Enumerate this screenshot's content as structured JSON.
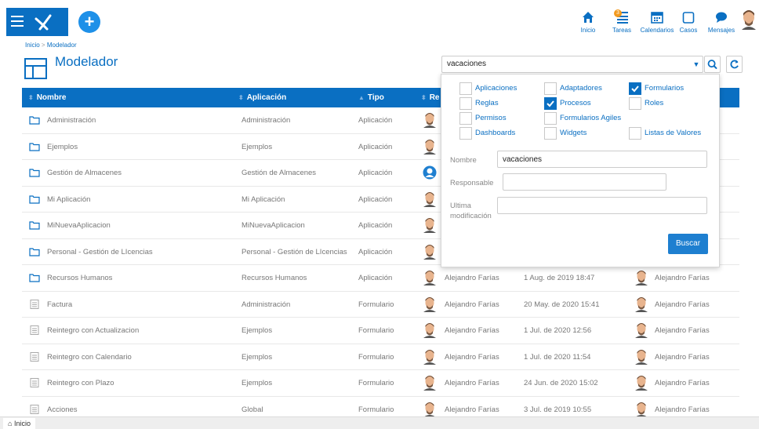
{
  "topbar": {
    "nav": [
      {
        "label": "Inicio",
        "icon": "home-icon"
      },
      {
        "label": "Tareas",
        "icon": "tasks-icon",
        "badge": "3"
      },
      {
        "label": "Calendarios",
        "icon": "calendar-icon"
      },
      {
        "label": "Casos",
        "icon": "cases-icon"
      },
      {
        "label": "Mensajes",
        "icon": "chat-icon"
      }
    ],
    "accent": "#0a6fc2"
  },
  "breadcrumb": {
    "root": "Inicio",
    "sep": ">",
    "current": "Modelador"
  },
  "page_title": "Modelador",
  "search": {
    "value": "vacaciones"
  },
  "table": {
    "headers": [
      "Nombre",
      "Aplicación",
      "Tipo",
      "Re"
    ],
    "rows": [
      {
        "name": "Administración",
        "app": "Administración",
        "type": "Aplicación",
        "kind": "folder",
        "resp": "",
        "date": "",
        "resp2": "",
        "avatar": "man"
      },
      {
        "name": "Ejemplos",
        "app": "Ejemplos",
        "type": "Aplicación",
        "kind": "folder",
        "resp": "",
        "date": "",
        "resp2": "",
        "avatar": "man"
      },
      {
        "name": "Gestión de Almacenes",
        "app": "Gestión de Almacenes",
        "type": "Aplicación",
        "kind": "folder",
        "resp": "",
        "date": "",
        "resp2": "",
        "avatar": "blue"
      },
      {
        "name": "Mi Aplicación",
        "app": "Mi Aplicación",
        "type": "Aplicación",
        "kind": "folder",
        "resp": "",
        "date": "",
        "resp2": "",
        "avatar": "man"
      },
      {
        "name": "MiNuevaAplicacion",
        "app": "MiNuevaAplicacion",
        "type": "Aplicación",
        "kind": "folder",
        "resp": "",
        "date": "",
        "resp2": "",
        "avatar": "man"
      },
      {
        "name": "Personal - Gestión de LIcencias",
        "app": "Personal - Gestión de LIcencias",
        "type": "Aplicación",
        "kind": "folder",
        "resp": "",
        "date": "",
        "resp2": "",
        "avatar": "man"
      },
      {
        "name": "Recursos Humanos",
        "app": "Recursos Humanos",
        "type": "Aplicación",
        "kind": "folder",
        "resp": "Alejandro Farías",
        "date": "1 Aug. de 2019 18:47",
        "resp2": "Alejandro Farías",
        "avatar": "man"
      },
      {
        "name": "Factura",
        "app": "Administración",
        "type": "Formulario",
        "kind": "form",
        "resp": "Alejandro Farías",
        "date": "20 May. de 2020 15:41",
        "resp2": "Alejandro Farías",
        "avatar": "man"
      },
      {
        "name": "Reintegro con Actualizacion",
        "app": "Ejemplos",
        "type": "Formulario",
        "kind": "form",
        "resp": "Alejandro Farías",
        "date": "1 Jul. de 2020 12:56",
        "resp2": "Alejandro Farías",
        "avatar": "man"
      },
      {
        "name": "Reintegro con Calendario",
        "app": "Ejemplos",
        "type": "Formulario",
        "kind": "form",
        "resp": "Alejandro Farías",
        "date": "1 Jul. de 2020 11:54",
        "resp2": "Alejandro Farías",
        "avatar": "man"
      },
      {
        "name": "Reintegro con Plazo",
        "app": "Ejemplos",
        "type": "Formulario",
        "kind": "form",
        "resp": "Alejandro Farías",
        "date": "24 Jun. de 2020 15:02",
        "resp2": "Alejandro Farías",
        "avatar": "man"
      },
      {
        "name": "Acciones",
        "app": "Global",
        "type": "Formulario",
        "kind": "form",
        "resp": "Alejandro Farías",
        "date": "3 Jul. de 2019 10:55",
        "resp2": "Alejandro Farías",
        "avatar": "man"
      }
    ]
  },
  "filter": {
    "options": [
      {
        "label": "Aplicaciones",
        "checked": false
      },
      {
        "label": "Adaptadores",
        "checked": false
      },
      {
        "label": "Formularios",
        "checked": true
      },
      {
        "label": "Reglas",
        "checked": false
      },
      {
        "label": "Procesos",
        "checked": true
      },
      {
        "label": "Roles",
        "checked": false
      },
      {
        "label": "Permisos",
        "checked": false
      },
      {
        "label": "Formularios Agiles",
        "checked": false
      },
      {
        "label": "Dashboards",
        "checked": false
      },
      {
        "label": "Widgets",
        "checked": false
      },
      {
        "label": "Listas de Valores",
        "checked": false
      }
    ],
    "nombre_label": "Nombre",
    "nombre_value": "vacaciones",
    "responsable_label": "Responsable",
    "responsable_value": "",
    "modif_label_1": "Ultima",
    "modif_label_2": "modificación",
    "modif_value": "",
    "buscar_label": "Buscar"
  },
  "bottombar": {
    "tab_label": "Inicio"
  }
}
